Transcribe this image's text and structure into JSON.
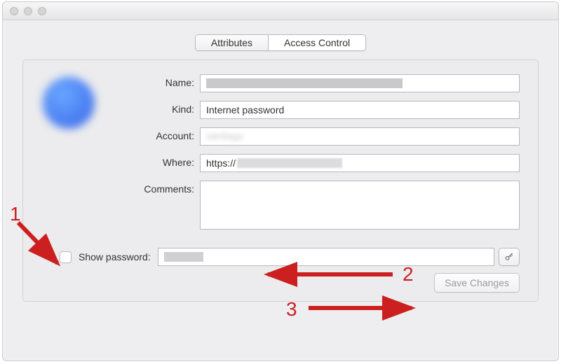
{
  "window": {
    "title": "                              "
  },
  "tabs": {
    "attributes": "Attributes",
    "access_control": "Access Control"
  },
  "labels": {
    "name": "Name:",
    "kind": "Kind:",
    "account": "Account:",
    "where": "Where:",
    "comments": "Comments:",
    "show_password": "Show password:"
  },
  "fields": {
    "name": "",
    "kind": "Internet password",
    "account": "",
    "where_prefix": "https://",
    "where_host": "",
    "comments": "",
    "password": ""
  },
  "buttons": {
    "save": "Save Changes"
  },
  "annotations": {
    "n1": "1",
    "n2": "2",
    "n3": "3"
  },
  "colors": {
    "annotation_red": "#cc1f1f"
  }
}
